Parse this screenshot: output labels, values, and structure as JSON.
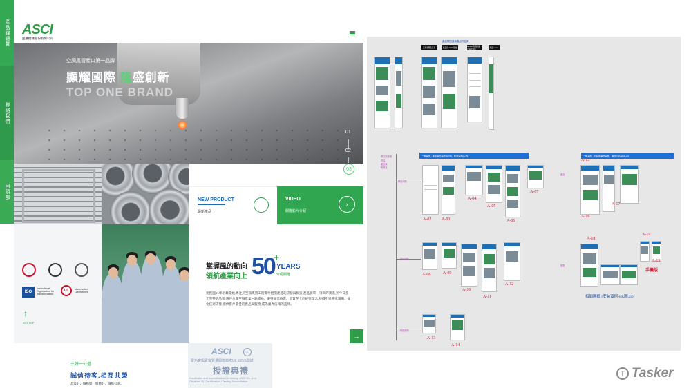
{
  "site": {
    "side_tabs": [
      "產品線總覽",
      "聯絡我們",
      "回頂部"
    ],
    "logo": "ASCI",
    "logo_sub": "國慶機械股份有限公司",
    "hero": {
      "sub": "空調風管產口第一品牌",
      "title_a": "顯耀國際 ",
      "title_b": "隆",
      "title_c": "盛創新",
      "en": "TOP ONE BRAND",
      "slides": [
        "01",
        "02",
        "03"
      ]
    },
    "tiles": {
      "new_product": {
        "title": "NEW PRODUCT",
        "sub": "最新產品"
      },
      "video": {
        "title": "VIDEO",
        "sub": "關隆影片介紹",
        "icon": "chevron-right-icon"
      }
    },
    "certs": {
      "iso_abbr": "ISO",
      "iso_name": "International Organization for Standardization",
      "ul_abbr": "UL",
      "ul_name": "Underwriters Laboratories",
      "go_top": "GO TOP"
    },
    "about": {
      "line1": "掌握風的動向",
      "line2": "領航產業向上",
      "years": "50",
      "plus": "+",
      "years_label": "YEARS",
      "intro": "介紹關隆",
      "paragraph": "從民國61年創業開始,專注於空調風管工程零件相關產品的研發與製造,產品從單一項目的演進,到今日多元完整的品項,陪伴台灣空調產業一路成長。秉持誠信待客、品質至上的經營理念,持續引進先進設備、強化技術研發,提供客戶最佳的產品與服務,成為業界信賴的品牌。"
    },
    "section2": {
      "tag": "三好一公道",
      "title": "誠信待客.相互共榮",
      "sub": "品質好、價格好、服務好、價格公道。"
    },
    "award": {
      "logo": "ASCI",
      "ul": "UL",
      "line1": "慶功宴與賓客質量開箱典禮UL 555/S測試",
      "title": "授證典禮",
      "line2a": "Installation and Accreditation Ceremony, ASCI Co., Ltd.",
      "line2b": "Obtained UL Certification / Testing Accreditation"
    }
  },
  "board": {
    "black_labels": [
      "首頁導覽及首頁",
      "產品頁LOGO型錄",
      "Banner頁面產品 安裝及照片",
      "產品 Hover"
    ],
    "top_caption": "產品類別頁與產品內容頁",
    "bars": {
      "a": "一級頁面 - 產品類別頁面(A-06)、產品頁面(A-09)",
      "b": "一級頁面 - 內頁與產品頁面、產品內容頁(A-13)",
      "c": "首頁導覽"
    },
    "legend_title": "網站架構圖",
    "legend_items": [
      "首頁",
      "產品頁",
      "聯絡頁"
    ],
    "pink_notes": [
      "網站導覽",
      "產品",
      "關於關隆",
      "客服",
      "聯絡我們"
    ],
    "labels": [
      "A-02",
      "A-03",
      "A-04",
      "A-05",
      "A-06",
      "A-07",
      "A-08",
      "A-09",
      "A-10",
      "A-11",
      "A-12",
      "A-13",
      "A-14",
      "A-15",
      "A-16",
      "A-17",
      "A-18",
      "A-19",
      "A-19"
    ],
    "mobile_label": "手機版",
    "zip_label": "相關圖檔 [安裝實例-FK圖.zip]"
  },
  "watermark": {
    "text": "Tasker",
    "icon": "tasker-logo-icon"
  }
}
